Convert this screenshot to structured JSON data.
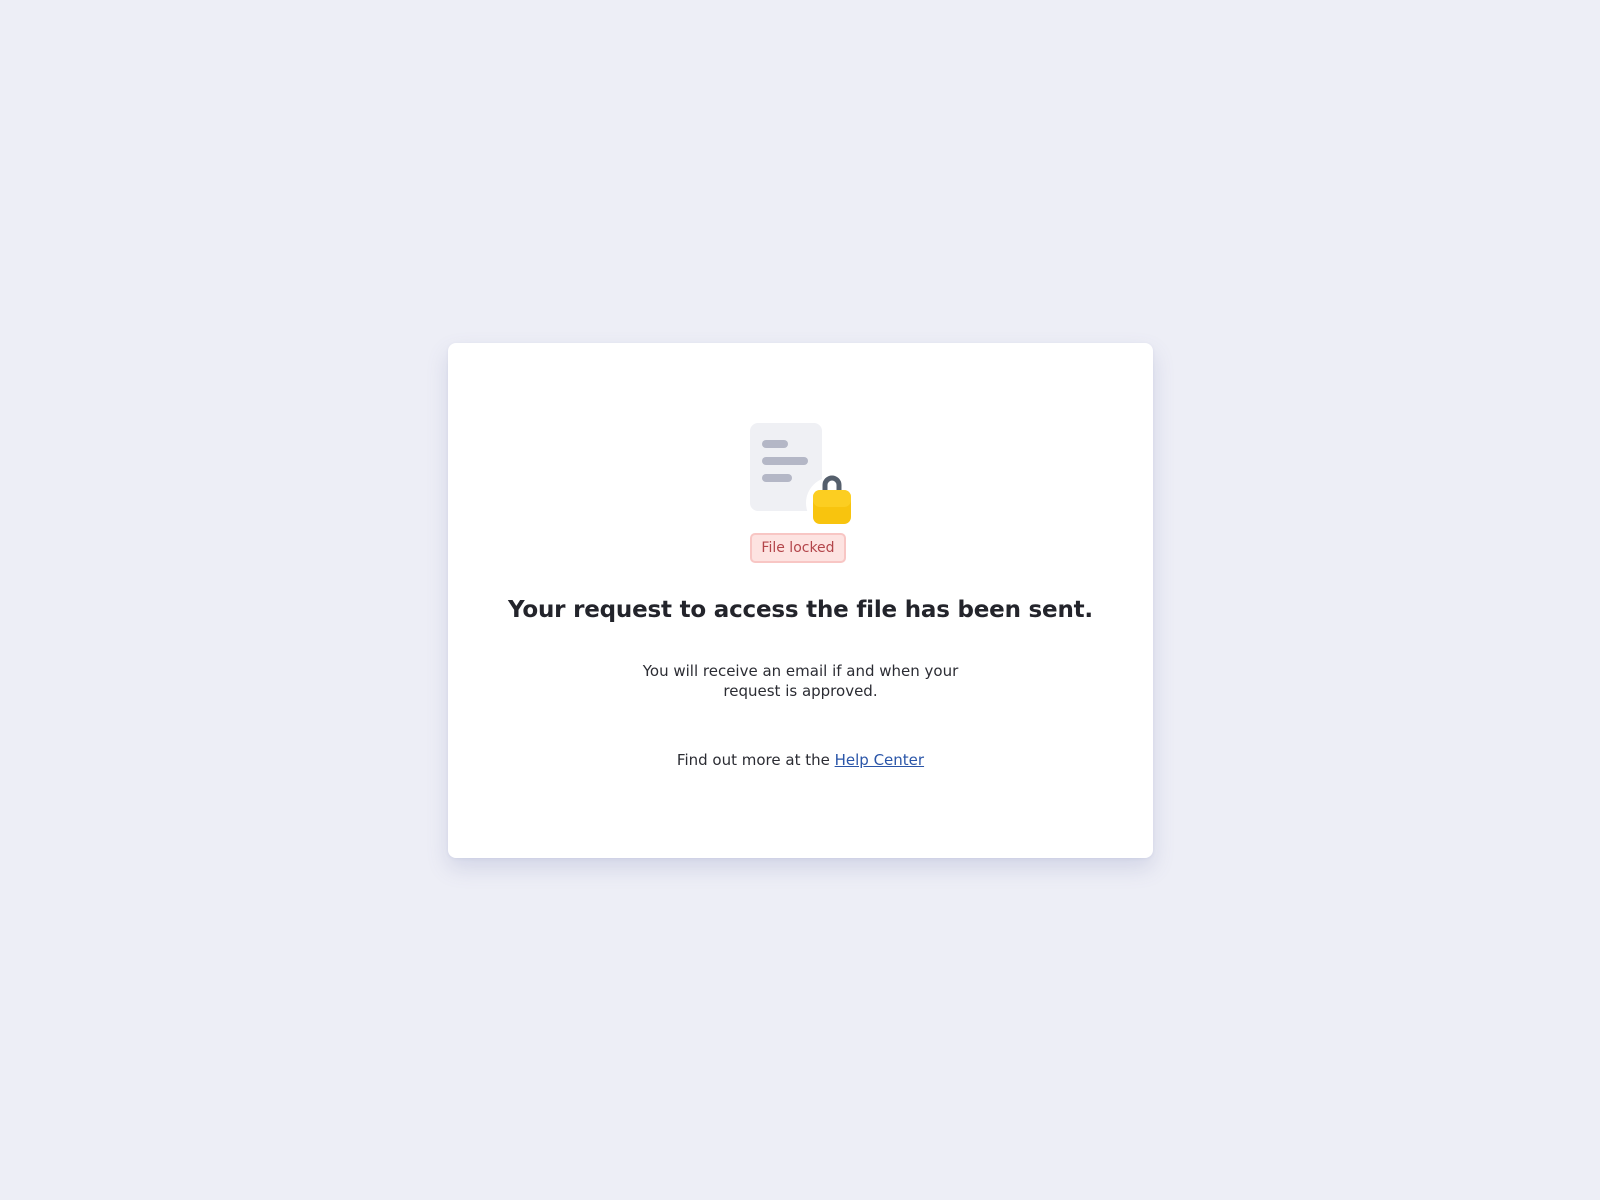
{
  "card": {
    "illustration": {
      "document_icon": "document-icon",
      "lock_icon": "padlock-icon",
      "colors": {
        "document": "#eff0f4",
        "document_lines": "#b4b7c6",
        "lock_body": "#f8c40e",
        "lock_shackle": "#555f6c"
      }
    },
    "badge": {
      "label": "File locked",
      "color": "#b3454a",
      "background": "#fde3e1"
    },
    "title": "Your request to access the file has been sent.",
    "message": "You will receive an email if and when your request is approved.",
    "help": {
      "prefix": "Find out more at the ",
      "link_label": "Help Center",
      "link_color": "#2a55a8"
    }
  },
  "page": {
    "background": "#edeef6"
  }
}
